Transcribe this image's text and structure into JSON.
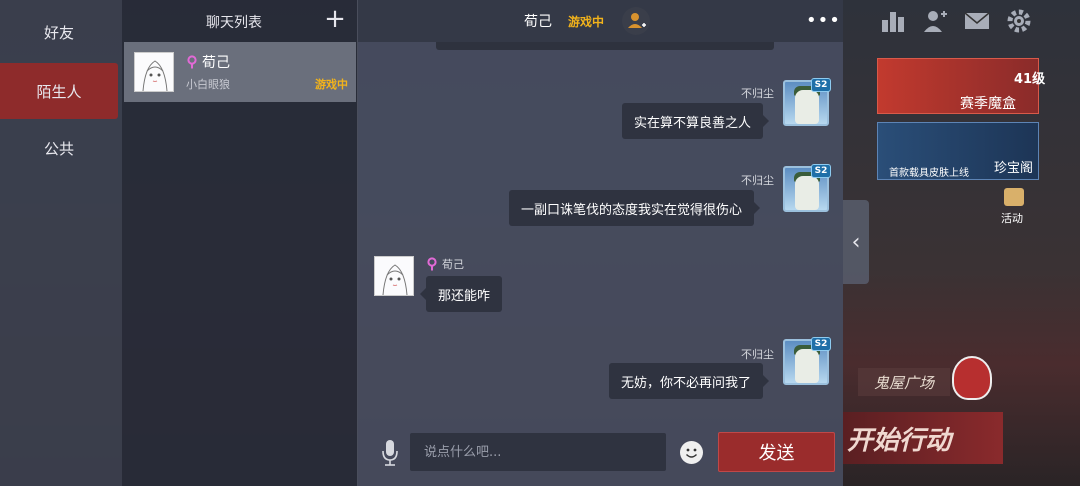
{
  "tabs": [
    {
      "label": "好友",
      "active": false
    },
    {
      "label": "陌生人",
      "active": true
    },
    {
      "label": "公共",
      "active": false
    }
  ],
  "chat_list": {
    "title": "聊天列表",
    "contacts": [
      {
        "name": "荀己",
        "subtitle": "小白眼狼",
        "status": "游戏中",
        "gender_icon": "female-icon"
      }
    ]
  },
  "chat": {
    "title": "荀己",
    "status": "游戏中",
    "messages": [
      {
        "sender": "不归尘",
        "side": "right",
        "text": "实在算不算良善之人"
      },
      {
        "sender": "不归尘",
        "side": "right",
        "text": "一副口诛笔伐的态度我实在觉得很伤心"
      },
      {
        "sender": "荀己",
        "side": "left",
        "text": "那还能咋"
      },
      {
        "sender": "不归尘",
        "side": "right",
        "text": "无妨，你不必再问我了"
      }
    ],
    "my_avatar_badge": "S2",
    "input_placeholder": "说点什么吧...",
    "send_label": "发送"
  },
  "game_ui": {
    "season_level": "41级",
    "season_box": "赛季魔盒",
    "shop_label": "珍宝阁",
    "shop_sub": "首款载具皮肤上线",
    "activity_label": "活动",
    "ghost_house": "鬼屋广场",
    "start_action": "开始行动"
  },
  "colors": {
    "accent_red": "#9a2c2c",
    "status_gold": "#f2b31b",
    "female_pink": "#e26ad6"
  }
}
